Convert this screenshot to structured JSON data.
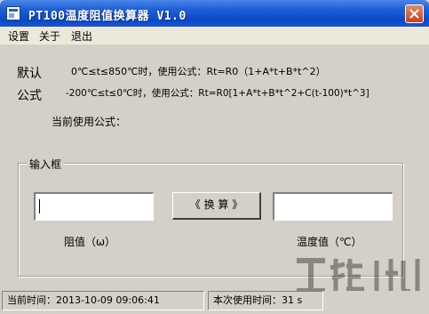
{
  "window": {
    "title": "PT100温度阻值换算器 V1.0"
  },
  "menu": {
    "items": [
      "设置",
      "关于",
      "退出"
    ]
  },
  "formula": {
    "label_line1": "默认",
    "label_line2": "公式",
    "range1": "0℃≤t≤850℃时，使用公式：Rt=R0（1+A*t+B*t^2）",
    "range2": "-200℃≤t≤0℃时，使用公式：Rt=R0[1+A*t+B*t^2+C(t-100)*t^3]",
    "current_label": "当前使用公式："
  },
  "input_group": {
    "title": "输入框",
    "resistance_value": "",
    "temperature_value": "",
    "convert_button": "《 换 算 》",
    "resistance_label": "阻值（ω）",
    "temperature_label": "温度值（℃）"
  },
  "status": {
    "current_time": "当前时间：2013-10-09 09:06:41",
    "usage_time": "本次使用时间：31 s"
  },
  "colors": {
    "titlebar": "#0a49c7",
    "window_bg": "#d4d0c8",
    "menubar_bg": "#ece9d8"
  }
}
